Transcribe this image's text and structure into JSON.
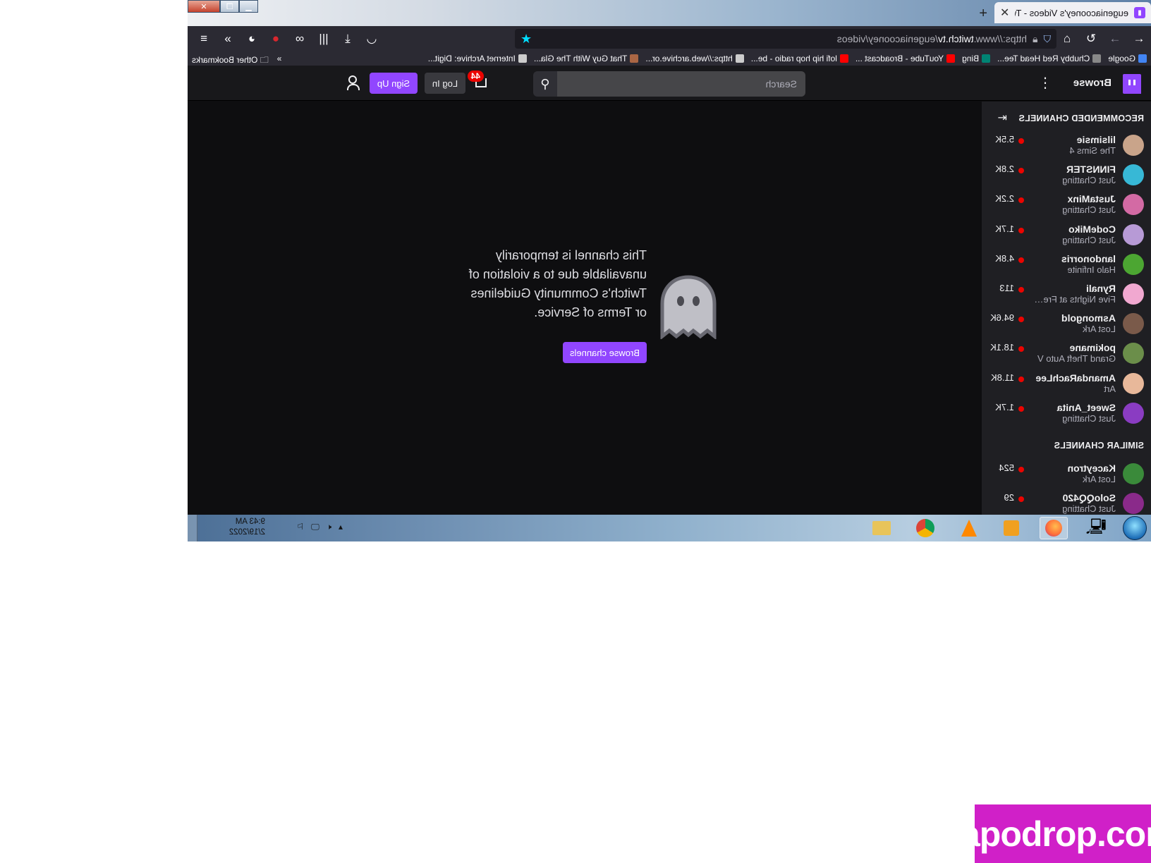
{
  "browser": {
    "tab_title": "eugeniacooney's Videos - Twitch",
    "tab_close": "✕",
    "new_tab": "+",
    "url_scheme": "https://www.",
    "url_host": "twitch.tv",
    "url_path": "/eugeniacooney/videos",
    "bookmarks": [
      {
        "label": "Google",
        "icon": "google-icon",
        "color": "#4285f4"
      },
      {
        "label": "Chubby Red Head Tee...",
        "icon": "raccoon-icon",
        "color": "#888888"
      },
      {
        "label": "Bing",
        "icon": "bing-icon",
        "color": "#008373"
      },
      {
        "label": "YouTube - Broadcast ...",
        "icon": "youtube-icon",
        "color": "#ff0000"
      },
      {
        "label": "lofi hip hop radio - be...",
        "icon": "youtube-icon",
        "color": "#ff0000"
      },
      {
        "label": "https://web.archive.or...",
        "icon": "archive-icon",
        "color": "#cccccc"
      },
      {
        "label": "That Guy With The Gla...",
        "icon": "avatar-icon",
        "color": "#aa6644"
      },
      {
        "label": "Internet Archive: Digit...",
        "icon": "archive-icon",
        "color": "#cccccc"
      }
    ],
    "other_bookmarks": "Other Bookmarks"
  },
  "twitch": {
    "browse": "Browse",
    "search_placeholder": "Search",
    "notif_count": "44",
    "login": "Log In",
    "signup": "Sign Up",
    "recommended_heading": "RECOMMENDED CHANNELS",
    "similar_heading": "SIMILAR CHANNELS",
    "recommended": [
      {
        "name": "lilsimsie",
        "game": "The Sims 4",
        "viewers": "5.5K",
        "color": "#c9a48a"
      },
      {
        "name": "FINNSTER",
        "game": "Just Chatting",
        "viewers": "2.8K",
        "color": "#37b8d6"
      },
      {
        "name": "JustaMinx",
        "game": "Just Chatting",
        "viewers": "2.2K",
        "color": "#d36aa4"
      },
      {
        "name": "CodeMiko",
        "game": "Just Chatting",
        "viewers": "1.7K",
        "color": "#b79ad6"
      },
      {
        "name": "landonorris",
        "game": "Halo Infinite",
        "viewers": "4.8K",
        "color": "#4ca632"
      },
      {
        "name": "Rynali",
        "game": "Five Nights at Fred...",
        "viewers": "113",
        "color": "#f1a8d0"
      },
      {
        "name": "Asmongold",
        "game": "Lost Ark",
        "viewers": "94.6K",
        "color": "#7a5a4a"
      },
      {
        "name": "pokimane",
        "game": "Grand Theft Auto V",
        "viewers": "18.1K",
        "color": "#6b8e4a"
      },
      {
        "name": "AmandaRachLee",
        "game": "Art",
        "viewers": "11.8K",
        "color": "#e8b89a"
      },
      {
        "name": "Sweet_Anita",
        "game": "Just Chatting",
        "viewers": "1.7K",
        "color": "#8a3cc2"
      }
    ],
    "similar": [
      {
        "name": "Kaceytron",
        "game": "Lost Ark",
        "viewers": "524",
        "color": "#3a8a3a"
      },
      {
        "name": "SoloQQ420",
        "game": "Just Chatting",
        "viewers": "29",
        "color": "#8a2a8a"
      }
    ],
    "message": "This channel is temporarily unavailable due to a violation of Twitch's Community Guidelines or Terms of Service.",
    "browse_channels": "Browse channels"
  },
  "taskbar": {
    "time": "9:43 AM",
    "date": "2/19/2022",
    "apps": [
      "computer-icon",
      "firefox-icon",
      "media-player-icon",
      "vlc-icon",
      "chrome-icon",
      "explorer-icon"
    ]
  },
  "watermark": "fapodrop.com",
  "colors": {
    "twitch_purple": "#9146ff",
    "live_red": "#eb0400",
    "bg_dark": "#0e0e10",
    "sidebar": "#1f1f23"
  }
}
